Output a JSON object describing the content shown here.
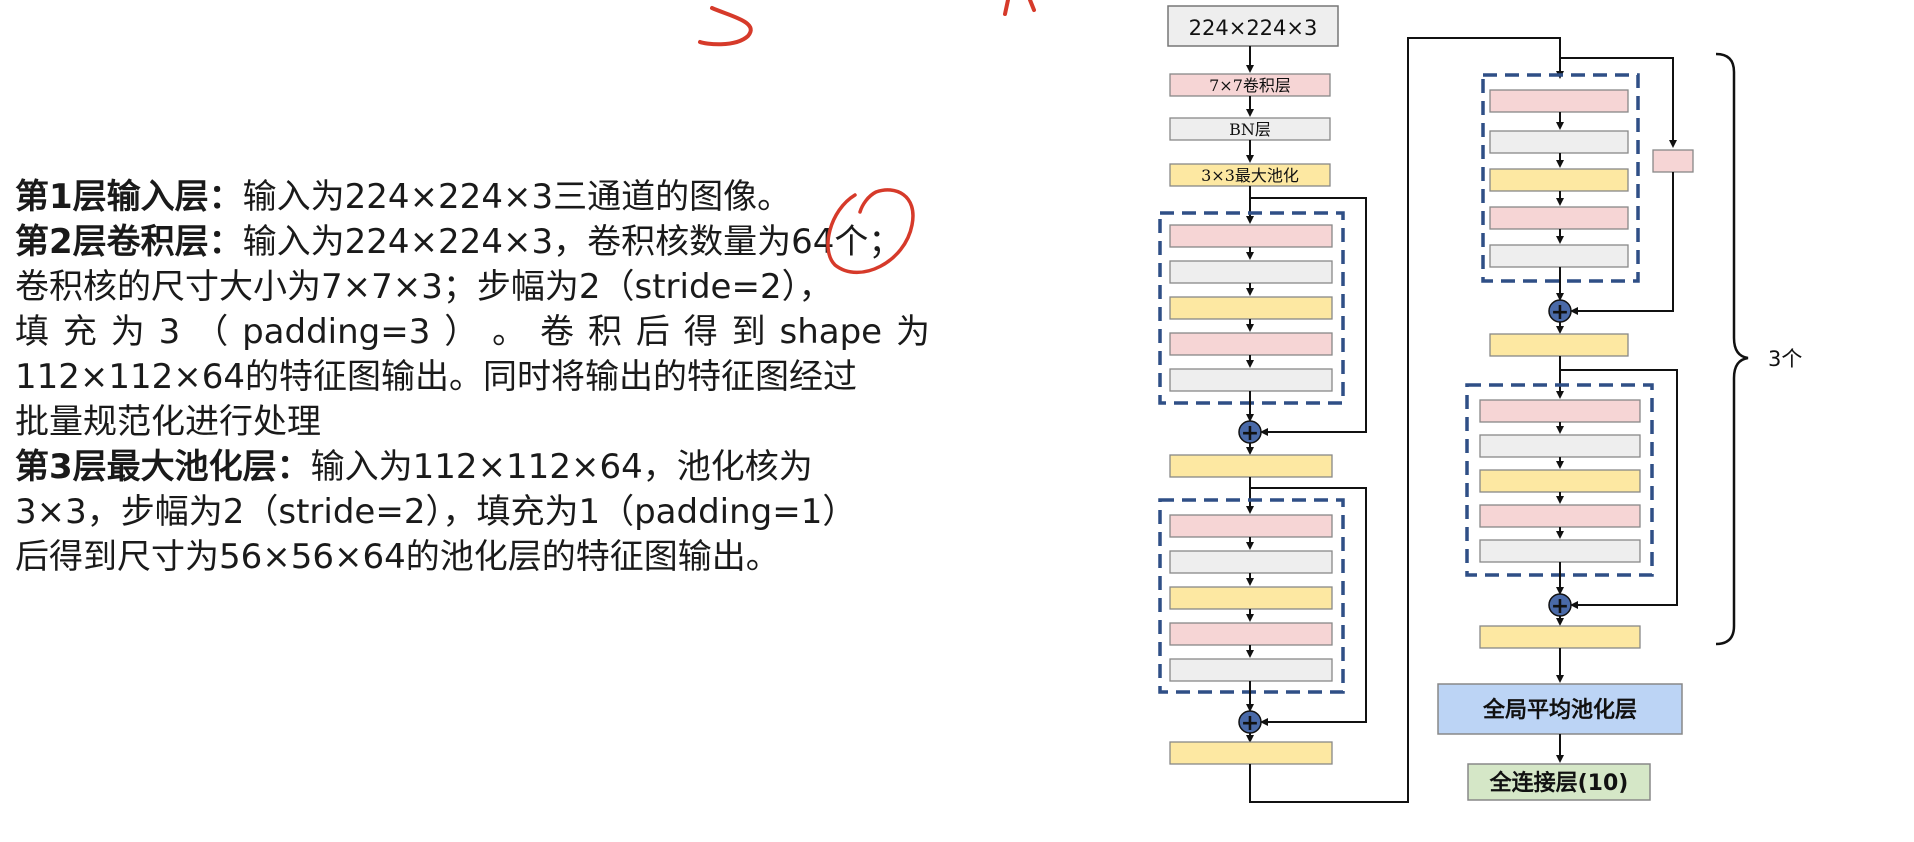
{
  "paragraphs": {
    "p1": {
      "head": "第1层输入层：",
      "body": "输入为224×224×3三通道的图像。"
    },
    "p2": {
      "head": "第2层卷积层：",
      "line1": "输入为224×224×3，卷积核数量为64个；",
      "line2": "卷积核的尺寸大小为7×7×3；步幅为2（stride=2），",
      "line3_parts": [
        "填",
        "充",
        "为",
        "3",
        "（",
        "padding=3",
        "）",
        "。",
        "卷",
        "积",
        "后",
        "得",
        "到",
        "shape",
        "为"
      ],
      "line4": "112×112×64的特征图输出。同时将输出的特征图经过",
      "line5": "批量规范化进行处理"
    },
    "p3": {
      "head": "第3层最大池化层：",
      "line1": "输入为112×112×64，池化核为",
      "line2": "3×3，步幅为2（stride=2），填充为1（padding=1）",
      "line3": "后得到尺寸为56×56×64的池化层的特征图输出。"
    }
  },
  "diagram": {
    "input_label": "224×224×3",
    "conv_label": "7×7卷积层",
    "bn_label": "BN层",
    "pool_label": "3×3最大池化",
    "repeat_label": "3个",
    "gap_label": "全局平均池化层",
    "fc_label": "全连接层(10)",
    "plus_symbol": "+"
  },
  "colors": {
    "pink": "#f6d5d5",
    "gray": "#eeeeee",
    "yellow": "#fde8a2",
    "blue_box": "#bcd4f5",
    "green_box": "#d5e7c7",
    "dashed_border": "#2f4f86",
    "annotation_red": "#d63a2a"
  }
}
